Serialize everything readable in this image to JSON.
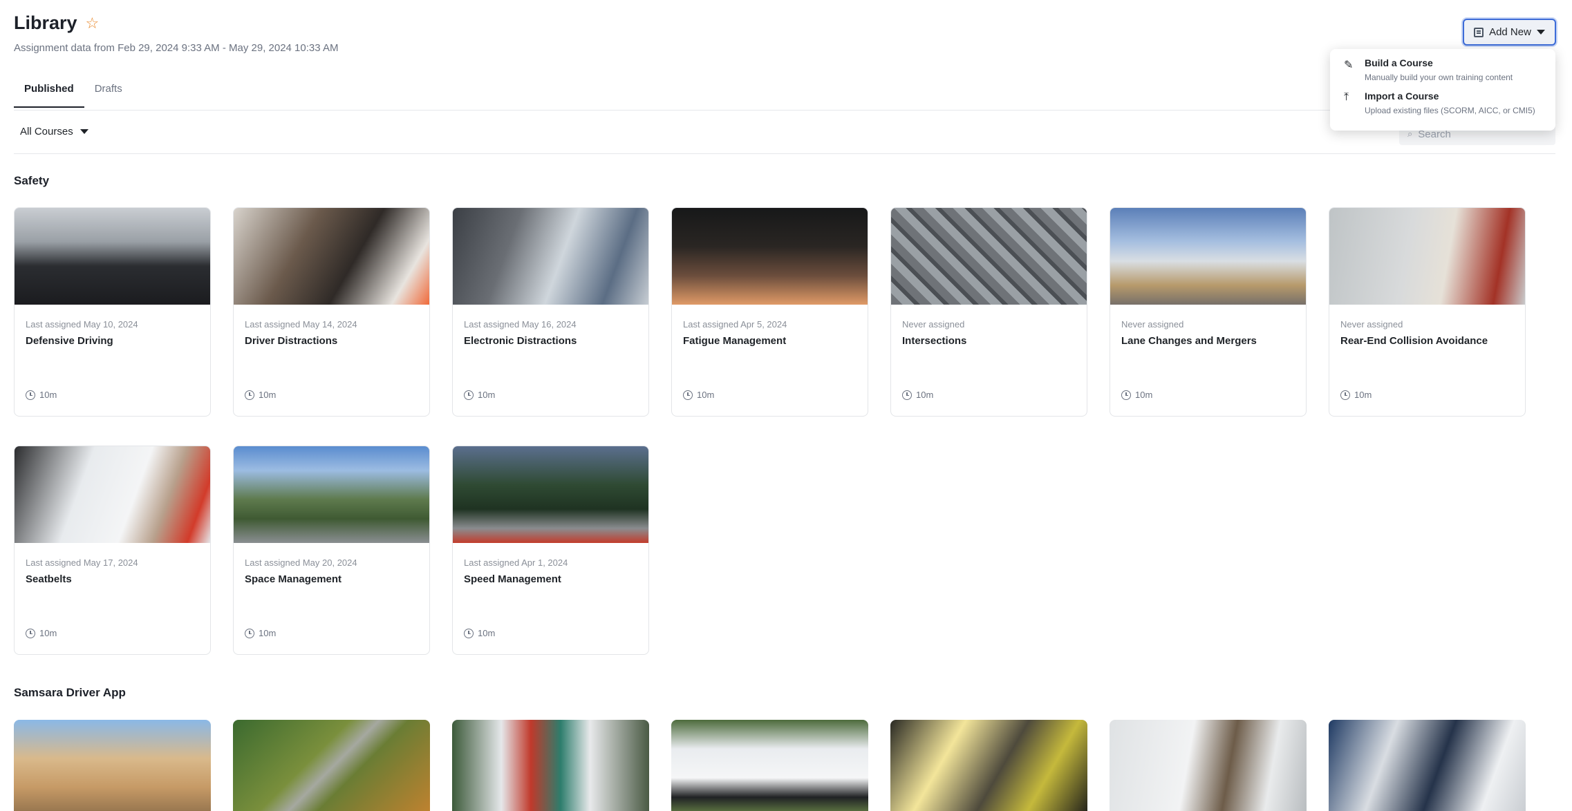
{
  "header": {
    "title": "Library",
    "subtitle": "Assignment data from Feb 29, 2024 9:33 AM - May 29, 2024 10:33 AM"
  },
  "add_new": {
    "label": "Add New",
    "menu": [
      {
        "title": "Build a Course",
        "desc": "Manually build your own training content",
        "icon": "pencil-icon"
      },
      {
        "title": "Import a Course",
        "desc": "Upload existing files (SCORM, AICC, or CMI5)",
        "icon": "upload-icon"
      }
    ]
  },
  "tabs": [
    {
      "label": "Published",
      "active": true
    },
    {
      "label": "Drafts",
      "active": false
    }
  ],
  "filter": {
    "label": "All Courses"
  },
  "search": {
    "placeholder": "Search"
  },
  "sections": {
    "safety": {
      "title": "Safety",
      "courses": [
        {
          "assigned": "Last assigned May 10, 2024",
          "name": "Defensive Driving",
          "duration": "10m"
        },
        {
          "assigned": "Last assigned May 14, 2024",
          "name": "Driver Distractions",
          "duration": "10m"
        },
        {
          "assigned": "Last assigned May 16, 2024",
          "name": "Electronic Distractions",
          "duration": "10m"
        },
        {
          "assigned": "Last assigned Apr 5, 2024",
          "name": "Fatigue Management",
          "duration": "10m"
        },
        {
          "assigned": "Never assigned",
          "name": "Intersections",
          "duration": "10m"
        },
        {
          "assigned": "Never assigned",
          "name": "Lane Changes and Mergers",
          "duration": "10m"
        },
        {
          "assigned": "Never assigned",
          "name": "Rear-End Collision Avoidance",
          "duration": "10m"
        },
        {
          "assigned": "Last assigned May 17, 2024",
          "name": "Seatbelts",
          "duration": "10m"
        },
        {
          "assigned": "Last assigned May 20, 2024",
          "name": "Space Management",
          "duration": "10m"
        },
        {
          "assigned": "Last assigned Apr 1, 2024",
          "name": "Speed Management",
          "duration": "10m"
        }
      ]
    },
    "driver_app": {
      "title": "Samsara Driver App"
    }
  }
}
